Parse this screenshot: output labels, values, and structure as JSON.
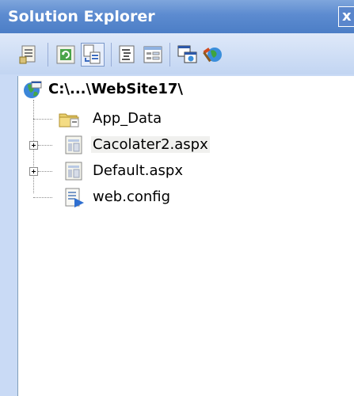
{
  "window": {
    "title": "Solution Explorer",
    "close_glyph": "x"
  },
  "toolbar": {
    "buttons": [
      {
        "icon": "properties-icon"
      },
      {
        "icon": "refresh-icon"
      },
      {
        "icon": "nest-related-files-icon"
      },
      {
        "icon": "view-code-icon"
      },
      {
        "icon": "view-designer-icon"
      },
      {
        "icon": "copy-website-icon"
      },
      {
        "icon": "asp-net-configuration-icon"
      }
    ]
  },
  "tree": {
    "root": {
      "label": "C:\\...\\WebSite17\\",
      "icon": "globe-website-icon"
    },
    "items": [
      {
        "label": "App_Data",
        "icon": "folder-icon",
        "expandable": false
      },
      {
        "label": "Cacolater2.aspx",
        "icon": "aspx-page-icon",
        "expandable": true,
        "selected": true
      },
      {
        "label": "Default.aspx",
        "icon": "aspx-page-icon",
        "expandable": true
      },
      {
        "label": "web.config",
        "icon": "config-file-icon",
        "expandable": false
      }
    ]
  }
}
